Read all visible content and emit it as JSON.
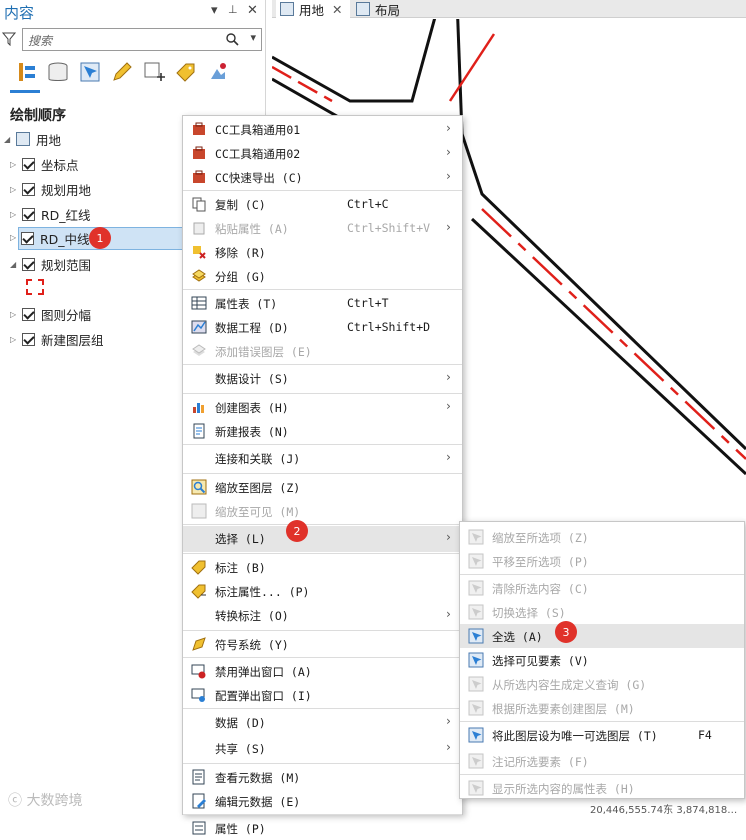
{
  "panel": {
    "title": "内容",
    "pin": "📌",
    "close": "✕",
    "collapse": "▾",
    "search_placeholder": "搜索",
    "heading": "绘制顺序"
  },
  "tree": {
    "root": "用地",
    "layers": [
      "坐标点",
      "规划用地",
      "RD_红线",
      "RD_中线",
      "规划范围",
      "图则分幅",
      "新建图层组"
    ],
    "legend_symbol": "[ ]"
  },
  "tabs": [
    "用地",
    "布局"
  ],
  "badges": [
    "1",
    "2",
    "3"
  ],
  "map_status": "20,446,555.74东 3,874,818…",
  "context_menu": [
    {
      "label": "CC工具箱通用01",
      "shortcut": "",
      "arrow": "›",
      "disabled": false,
      "icon": "toolbox-icon"
    },
    {
      "label": "CC工具箱通用02",
      "shortcut": "",
      "arrow": "›",
      "disabled": false,
      "icon": "toolbox-icon"
    },
    {
      "label": "CC快速导出 (C)",
      "shortcut": "",
      "arrow": "›",
      "disabled": false,
      "icon": "toolbox-icon"
    },
    {
      "label": "复制 (C)",
      "shortcut": "Ctrl+C",
      "arrow": "",
      "disabled": false,
      "icon": "copy-icon"
    },
    {
      "label": "粘贴属性 (A)",
      "shortcut": "Ctrl+Shift+V",
      "arrow": "›",
      "disabled": true,
      "icon": "paste-icon"
    },
    {
      "label": "移除 (R)",
      "shortcut": "",
      "arrow": "",
      "disabled": false,
      "icon": "remove-icon"
    },
    {
      "label": "分组 (G)",
      "shortcut": "",
      "arrow": "",
      "disabled": false,
      "icon": "group-icon"
    },
    {
      "label": "属性表 (T)",
      "shortcut": "Ctrl+T",
      "arrow": "",
      "disabled": false,
      "icon": "table-icon"
    },
    {
      "label": "数据工程 (D)",
      "shortcut": "Ctrl+Shift+D",
      "arrow": "",
      "disabled": false,
      "icon": "data-engineering-icon"
    },
    {
      "label": "添加错误图层 (E)",
      "shortcut": "",
      "arrow": "",
      "disabled": true,
      "icon": "layers-icon"
    },
    {
      "label": "数据设计 (S)",
      "shortcut": "",
      "arrow": "›",
      "disabled": false,
      "icon": ""
    },
    {
      "label": "创建图表 (H)",
      "shortcut": "",
      "arrow": "›",
      "disabled": false,
      "icon": "chart-icon"
    },
    {
      "label": "新建报表 (N)",
      "shortcut": "",
      "arrow": "",
      "disabled": false,
      "icon": "report-icon"
    },
    {
      "label": "连接和关联 (J)",
      "shortcut": "",
      "arrow": "›",
      "disabled": false,
      "icon": ""
    },
    {
      "label": "缩放至图层 (Z)",
      "shortcut": "",
      "arrow": "",
      "disabled": false,
      "icon": "zoom-layer-icon"
    },
    {
      "label": "缩放至可见 (M)",
      "shortcut": "",
      "arrow": "",
      "disabled": true,
      "icon": "zoom-visible-icon"
    },
    {
      "label": "选择 (L)",
      "shortcut": "",
      "arrow": "›",
      "disabled": false,
      "icon": ""
    },
    {
      "label": "标注 (B)",
      "shortcut": "",
      "arrow": "",
      "disabled": false,
      "icon": "label-icon"
    },
    {
      "label": "标注属性... (P)",
      "shortcut": "",
      "arrow": "",
      "disabled": false,
      "icon": "label-props-icon"
    },
    {
      "label": "转换标注 (O)",
      "shortcut": "",
      "arrow": "›",
      "disabled": false,
      "icon": ""
    },
    {
      "label": "符号系统 (Y)",
      "shortcut": "",
      "arrow": "",
      "disabled": false,
      "icon": "symbology-icon"
    },
    {
      "label": "禁用弹出窗口 (A)",
      "shortcut": "",
      "arrow": "",
      "disabled": false,
      "icon": "popup-disable-icon"
    },
    {
      "label": "配置弹出窗口 (I)",
      "shortcut": "",
      "arrow": "",
      "disabled": false,
      "icon": "popup-config-icon"
    },
    {
      "label": "数据 (D)",
      "shortcut": "",
      "arrow": "›",
      "disabled": false,
      "icon": ""
    },
    {
      "label": "共享 (S)",
      "shortcut": "",
      "arrow": "›",
      "disabled": false,
      "icon": ""
    },
    {
      "label": "查看元数据 (M)",
      "shortcut": "",
      "arrow": "",
      "disabled": false,
      "icon": "metadata-view-icon"
    },
    {
      "label": "编辑元数据 (E)",
      "shortcut": "",
      "arrow": "",
      "disabled": false,
      "icon": "metadata-edit-icon"
    },
    {
      "label": "属性 (P)",
      "shortcut": "",
      "arrow": "",
      "disabled": false,
      "icon": "properties-icon"
    }
  ],
  "submenu": [
    {
      "label": "缩放至所选项 (Z)",
      "shortcut": "",
      "disabled": true
    },
    {
      "label": "平移至所选项 (P)",
      "shortcut": "",
      "disabled": true
    },
    {
      "label": "清除所选内容 (C)",
      "shortcut": "",
      "disabled": true
    },
    {
      "label": "切换选择 (S)",
      "shortcut": "",
      "disabled": true
    },
    {
      "label": "全选 (A)",
      "shortcut": "",
      "disabled": false
    },
    {
      "label": "选择可见要素 (V)",
      "shortcut": "",
      "disabled": false
    },
    {
      "label": "从所选内容生成定义查询 (G)",
      "shortcut": "",
      "disabled": true
    },
    {
      "label": "根据所选要素创建图层 (M)",
      "shortcut": "",
      "disabled": true
    },
    {
      "label": "将此图层设为唯一可选图层 (T)",
      "shortcut": "F4",
      "disabled": false
    },
    {
      "label": "注记所选要素 (F)",
      "shortcut": "",
      "disabled": true
    },
    {
      "label": "显示所选内容的属性表 (H)",
      "shortcut": "",
      "disabled": true
    }
  ],
  "watermark": "大数跨境",
  "colors": {
    "accent": "#1f6fb2",
    "badge": "#e0322a",
    "road_center": "#e0201a"
  }
}
